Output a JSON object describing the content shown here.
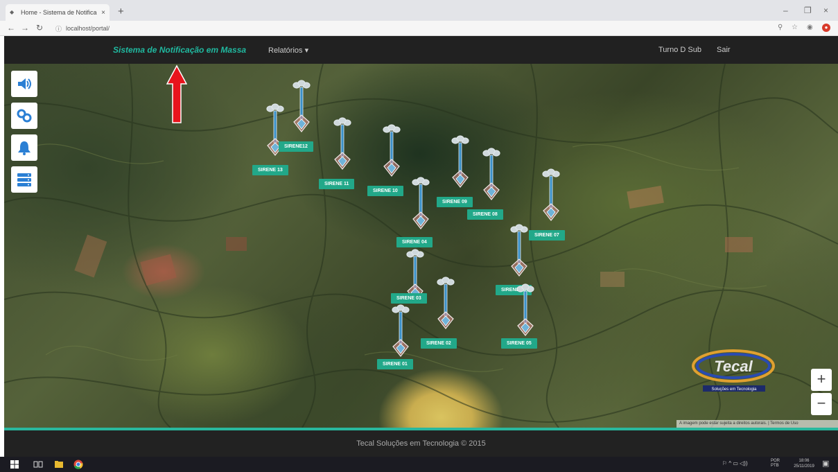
{
  "browser": {
    "tab_title": "Home - Sistema de Notificação",
    "tab_close": "×",
    "new_tab": "+",
    "url": "localhost/portal/",
    "win_minimize": "–",
    "win_maximize": "❐",
    "win_close": "×"
  },
  "app": {
    "brand": "Sistema de Notificação em Massa",
    "menu_reports": "Relatórios ▾",
    "user": "Turno D Sub",
    "logout": "Sair"
  },
  "map": {
    "controls": [
      {
        "icon": "speaker-icon"
      },
      {
        "icon": "link-icon"
      },
      {
        "icon": "bell-icon"
      },
      {
        "icon": "server-list-icon"
      }
    ],
    "zoom_in": "+",
    "zoom_out": "−",
    "attribution": "A imagem pode estar sujeita a direitos autorais. | Termos de Uso",
    "logo_text": "Tecal",
    "logo_subtext": "Soluções em Tecnologia",
    "sirens": [
      {
        "label": "SIRENE 13"
      },
      {
        "label": "SIRENE12"
      },
      {
        "label": "SIRENE 11"
      },
      {
        "label": "SIRENE 10"
      },
      {
        "label": "SIRENE 09"
      },
      {
        "label": "SIRENE 08"
      },
      {
        "label": "SIRENE 07"
      },
      {
        "label": "SIRENE 04"
      },
      {
        "label": "SIRENE 06"
      },
      {
        "label": "SIRENE 03"
      },
      {
        "label": "SIRENE 02"
      },
      {
        "label": "SIRENE 05"
      },
      {
        "label": "SIRENE 01"
      }
    ]
  },
  "footer": {
    "text": "Tecal Soluções em Tecnologia © 2015"
  },
  "taskbar": {
    "tray_lang": "POR PTB",
    "tray_time": "18:06",
    "tray_date": "25/11/2019"
  },
  "colors": {
    "accent": "#22a889",
    "brand": "#20b9a0",
    "navbar": "#212121",
    "annotation_arrow": "#e8141c"
  }
}
